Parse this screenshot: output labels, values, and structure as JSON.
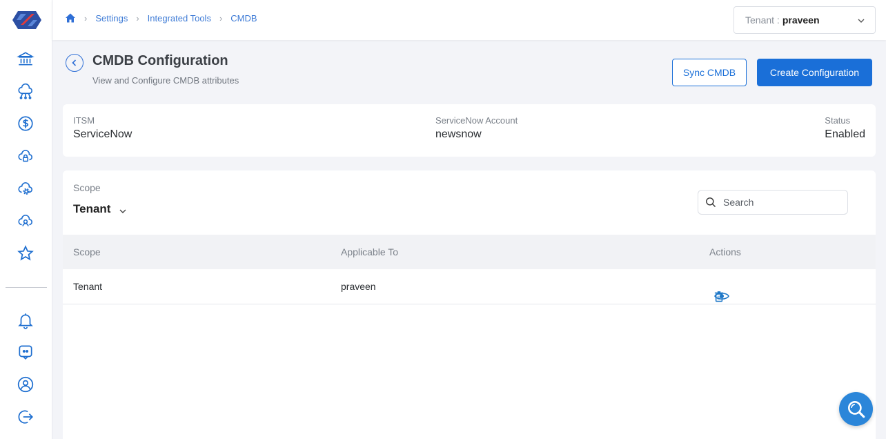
{
  "breadcrumb": {
    "items": [
      {
        "label": "Settings"
      },
      {
        "label": "Integrated Tools"
      },
      {
        "label": "CMDB"
      }
    ]
  },
  "tenant_selector": {
    "label": "Tenant :",
    "value": "praveen"
  },
  "page": {
    "title": "CMDB Configuration",
    "subtitle": "View and Configure CMDB attributes",
    "sync_button": "Sync CMDB",
    "create_button": "Create Configuration"
  },
  "info": {
    "itsm_label": "ITSM",
    "itsm_value": "ServiceNow",
    "account_label": "ServiceNow Account",
    "account_value": "newsnow",
    "status_label": "Status",
    "status_value": "Enabled"
  },
  "scope_filter": {
    "label": "Scope",
    "value": "Tenant"
  },
  "search": {
    "placeholder": "Search"
  },
  "table": {
    "columns": [
      "Scope",
      "Applicable To",
      "Actions"
    ],
    "rows": [
      {
        "scope": "Tenant",
        "applicable_to": "praveen"
      }
    ]
  },
  "colors": {
    "primary": "#1a6fd8",
    "link": "#3e7bd6",
    "icon": "#1f6fd0"
  },
  "sidebar_icons": [
    "bank-icon",
    "cloud-network-icon",
    "dollar-icon",
    "cloud-lock-icon",
    "cloud-gear-icon",
    "cloud-user-icon",
    "star-icon",
    "bell-icon",
    "chat-icon",
    "user-circle-icon",
    "logout-icon"
  ]
}
